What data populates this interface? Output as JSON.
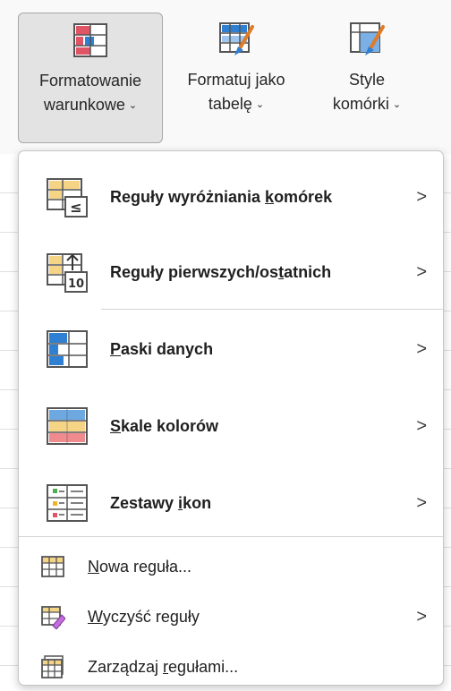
{
  "ribbon": {
    "conditional_formatting": {
      "line1": "Formatowanie",
      "line2": "warunkowe"
    },
    "format_as_table": {
      "line1": "Formatuj jako",
      "line2": "tabelę"
    },
    "cell_styles": {
      "line1": "Style",
      "line2": "komórki"
    }
  },
  "menu": {
    "highlight_rules": {
      "pre": "Reguły wyróżniania ",
      "ul": "k",
      "post": "omórek"
    },
    "top_bottom_rules": {
      "pre": "Reguły pierwszych/os",
      "ul": "t",
      "post": "atnich"
    },
    "data_bars": {
      "pre": "",
      "ul": "P",
      "post": "aski danych"
    },
    "color_scales": {
      "pre": "",
      "ul": "S",
      "post": "kale kolorów"
    },
    "icon_sets": {
      "pre": "Zestawy ",
      "ul": "i",
      "post": "kon"
    },
    "new_rule": {
      "pre": "",
      "ul": "N",
      "post": "owa reguła..."
    },
    "clear_rules": {
      "pre": "",
      "ul": "W",
      "post": "yczyść reguły"
    },
    "manage_rules": {
      "pre": "Zarządzaj ",
      "ul": "r",
      "post": "egułami..."
    },
    "submenu_arrow": ">"
  },
  "icons": {
    "highlight_rules_badge": "≤",
    "top_bottom_badge": "10"
  },
  "colors": {
    "accent_red": "#e05566",
    "accent_blue": "#2f7fd3",
    "accent_yellow": "#f6d486",
    "accent_green": "#4caf50"
  }
}
